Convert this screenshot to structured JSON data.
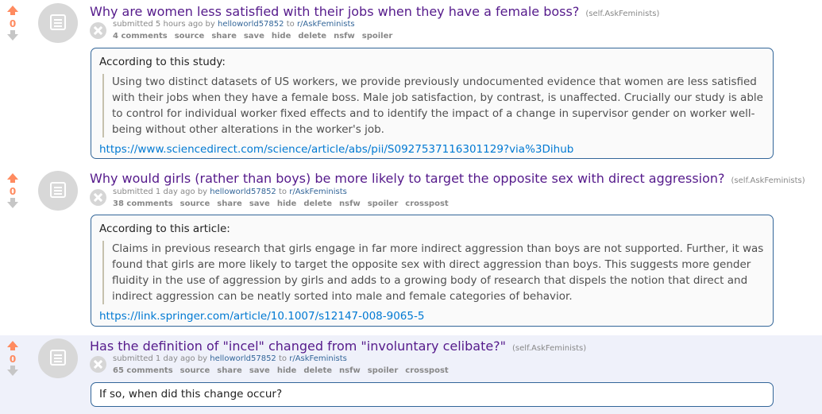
{
  "posts": [
    {
      "score": "0",
      "title": "Why are women less satisfied with their jobs when they have a female boss?",
      "domain": "(self.AskFeminists)",
      "tagline_prefix": "submitted 5 hours ago by",
      "author": "helloworld57852",
      "to": "to",
      "subreddit": "r/AskFeminists",
      "buttons": [
        "4 comments",
        "source",
        "share",
        "save",
        "hide",
        "delete",
        "nsfw",
        "spoiler"
      ],
      "intro": "According to this study:",
      "quote": "Using two distinct datasets of US workers, we provide previously undocumented evidence that women are less satisfied with their jobs when they have a female boss. Male job satisfaction, by contrast, is unaffected. Crucially our study is able to control for individual worker fixed effects and to identify the impact of a change in supervisor gender on worker well-being without other alterations in the worker's job.",
      "link": "https://www.sciencedirect.com/science/article/abs/pii/S0927537116301129?via%3Dihub"
    },
    {
      "score": "0",
      "title": "Why would girls (rather than boys) be more likely to target the opposite sex with direct aggression?",
      "domain": "(self.AskFeminists)",
      "tagline_prefix": "submitted 1 day ago by",
      "author": "helloworld57852",
      "to": "to",
      "subreddit": "r/AskFeminists",
      "buttons": [
        "38 comments",
        "source",
        "share",
        "save",
        "hide",
        "delete",
        "nsfw",
        "spoiler",
        "crosspost"
      ],
      "intro": "According to this article:",
      "quote": "Claims in previous research that girls engage in far more indirect aggression than boys are not supported. Further, it was found that girls are more likely to target the opposite sex with direct aggression than boys. This suggests more gender fluidity in the use of aggression by girls and adds to a growing body of research that dispels the notion that direct and indirect aggression can be neatly sorted into male and female categories of behavior.",
      "link": "https://link.springer.com/article/10.1007/s12147-008-9065-5"
    },
    {
      "score": "0",
      "title": "Has the definition of \"incel\" changed from \"involuntary celibate?\"",
      "domain": "(self.AskFeminists)",
      "tagline_prefix": "submitted 1 day ago by",
      "author": "helloworld57852",
      "to": "to",
      "subreddit": "r/AskFeminists",
      "buttons": [
        "65 comments",
        "source",
        "share",
        "save",
        "hide",
        "delete",
        "nsfw",
        "spoiler",
        "crosspost"
      ],
      "intro": "If so, when did this change occur?"
    }
  ],
  "colors": {
    "title": "#551a8b",
    "upvote": "#ff8b60",
    "link": "#0079d3",
    "box_border": "#336699",
    "highlight_bg": "#eff1fa"
  },
  "icons": {
    "upvote": "upvote-arrow-icon",
    "downvote": "downvote-arrow-icon",
    "thumbnail": "self-post-document-icon",
    "expando": "close-expando-icon"
  }
}
